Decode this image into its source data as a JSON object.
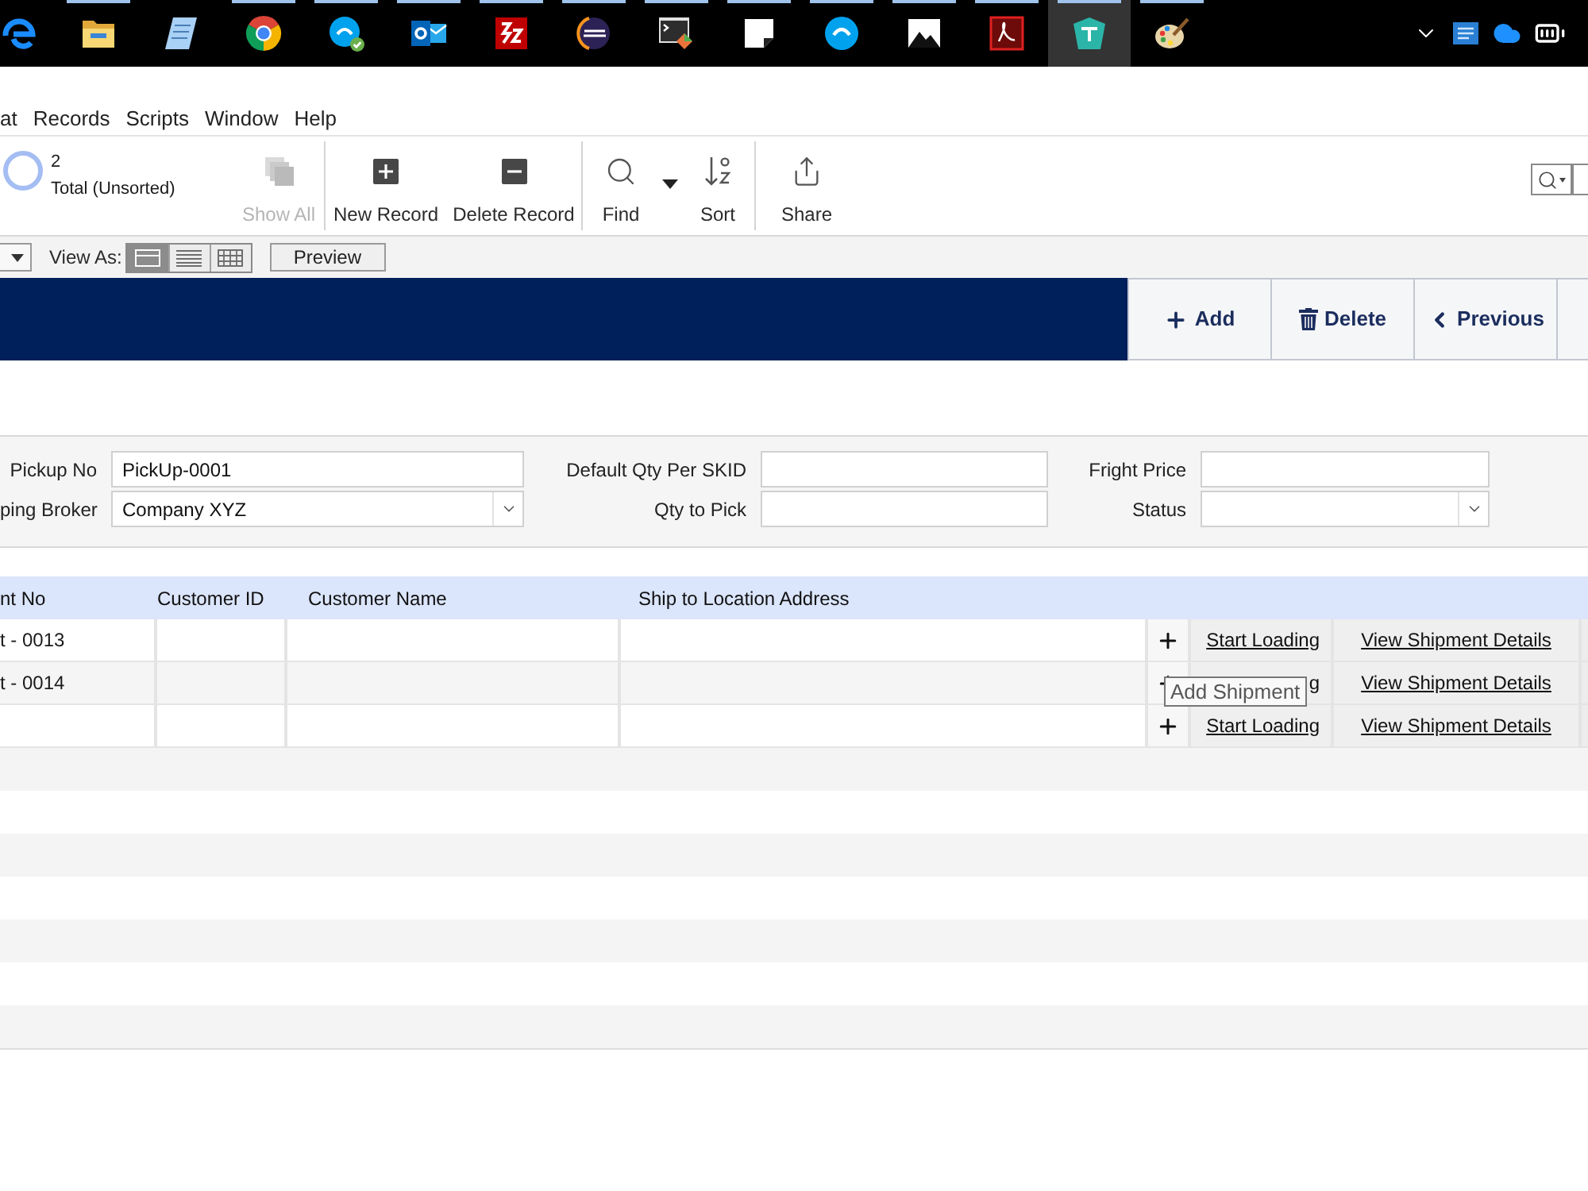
{
  "taskbar": {
    "apps": [
      {
        "kind": "e-logo",
        "running": false,
        "selected": false
      },
      {
        "kind": "folder",
        "running": true,
        "selected": false
      },
      {
        "kind": "notebook",
        "running": false,
        "selected": false
      },
      {
        "kind": "ring-logo",
        "running": true,
        "selected": false
      },
      {
        "kind": "chat-badge",
        "running": true,
        "selected": false
      },
      {
        "kind": "mail",
        "running": true,
        "selected": false
      },
      {
        "kind": "red-tile",
        "running": true,
        "selected": false
      },
      {
        "kind": "eclipse",
        "running": true,
        "selected": false
      },
      {
        "kind": "terminal",
        "running": true,
        "selected": false
      },
      {
        "kind": "note",
        "running": true,
        "selected": false
      },
      {
        "kind": "chat",
        "running": true,
        "selected": false
      },
      {
        "kind": "photo",
        "running": true,
        "selected": false
      },
      {
        "kind": "document",
        "running": true,
        "selected": false
      },
      {
        "kind": "teal-app",
        "running": true,
        "selected": true
      },
      {
        "kind": "palette",
        "running": true,
        "selected": false
      }
    ]
  },
  "menu": [
    "at",
    "Records",
    "Scripts",
    "Window",
    "Help"
  ],
  "toolbar": {
    "record_count": "2",
    "sort_status": "Total (Unsorted)",
    "groups": [
      {
        "buttons": [
          {
            "kind": "show-all",
            "label": "Show All",
            "disabled": true
          }
        ]
      },
      {
        "buttons": [
          {
            "kind": "new-record",
            "label": "New Record",
            "disabled": false
          },
          {
            "kind": "delete-record",
            "label": "Delete Record",
            "disabled": false
          }
        ]
      },
      {
        "buttons": [
          {
            "kind": "find",
            "label": "Find",
            "disabled": false
          },
          {
            "kind": "sort",
            "label": "Sort",
            "disabled": false
          }
        ]
      },
      {
        "buttons": [
          {
            "kind": "share",
            "label": "Share",
            "disabled": false
          }
        ]
      }
    ]
  },
  "layout_bar": {
    "label": "View As:",
    "views": [
      {
        "kind": "form",
        "selected": true
      },
      {
        "kind": "list",
        "selected": false
      },
      {
        "kind": "table",
        "selected": false
      }
    ],
    "preview": "Preview"
  },
  "header": {
    "buttons": [
      {
        "kind": "add",
        "label": "Add"
      },
      {
        "kind": "delete",
        "label": "Delete"
      },
      {
        "kind": "previous",
        "label": "Previous"
      }
    ]
  },
  "form": {
    "columns": [
      {
        "fields": [
          {
            "label": "Pickup No",
            "kind": "text",
            "value": "PickUp-0001"
          },
          {
            "label": "ping Broker",
            "kind": "dropdown",
            "value": "Company XYZ"
          }
        ]
      },
      {
        "fields": [
          {
            "label": "Default Qty Per SKID",
            "kind": "text"
          },
          {
            "label": "Qty to Pick",
            "kind": "text"
          }
        ]
      },
      {
        "fields": [
          {
            "label": "Fright Price",
            "kind": "text"
          },
          {
            "label": "Status",
            "kind": "dropdown"
          }
        ]
      }
    ]
  },
  "table": {
    "columns": [
      "nt No",
      "Customer ID",
      "Customer Name",
      "Ship to Location Address"
    ],
    "rows": [
      {
        "column_1": "t - 0013",
        "start_loading": "Start Loading",
        "details": "View Shipment Details"
      },
      {
        "column_1": "t - 0014",
        "start_loading": "g",
        "details": "View Shipment Details",
        "tooltip": "Add Shipment"
      },
      {
        "start_loading": "Start Loading",
        "details": "View Shipment Details"
      }
    ]
  }
}
